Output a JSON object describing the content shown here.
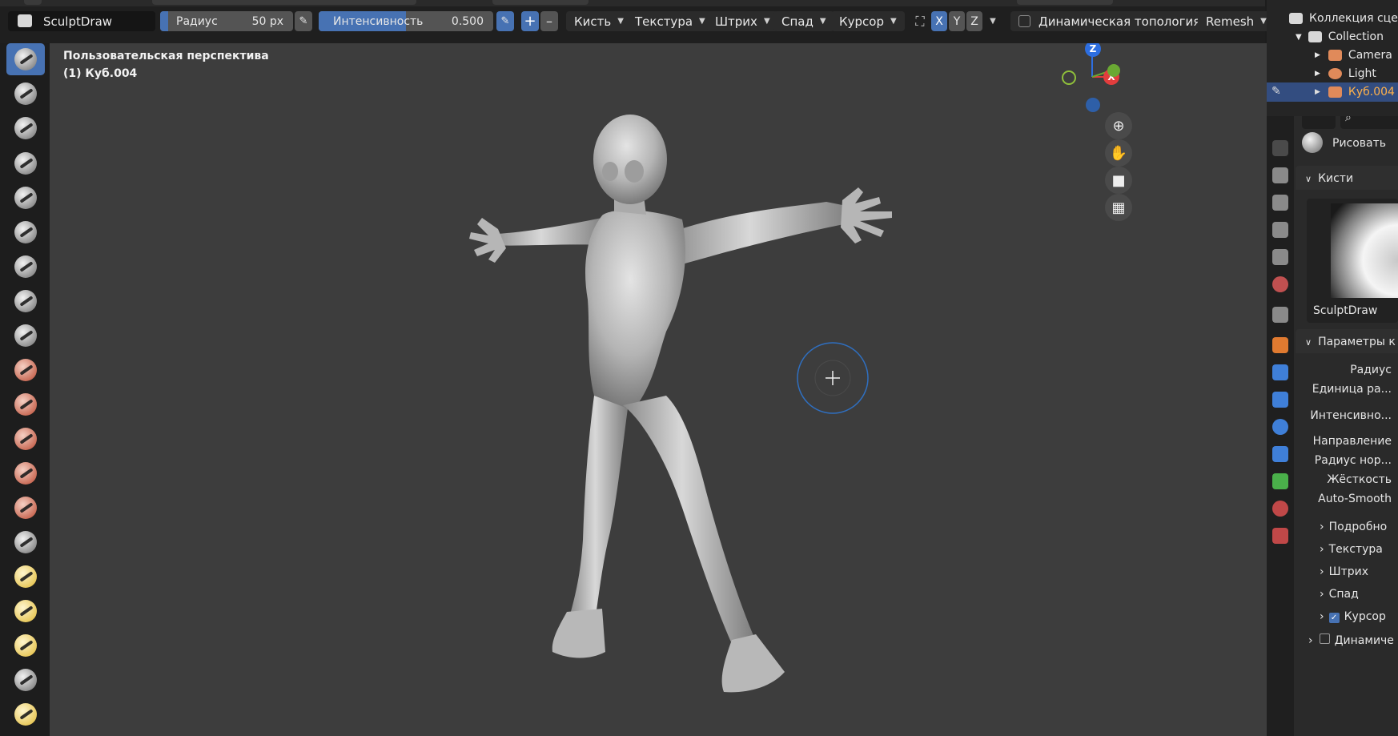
{
  "header": {
    "brush_name": "SculptDraw",
    "radius_label": "Радиус",
    "radius_value": "50 px",
    "strength_label": "Интенсивность",
    "strength_value": "0.500",
    "plus": "+",
    "minus": "–",
    "menus": [
      "Кисть",
      "Текстура",
      "Штрих",
      "Спад",
      "Курсор"
    ],
    "axes": [
      "X",
      "Y",
      "Z"
    ],
    "dyntopo_label": "Динамическая топология",
    "remesh_label": "Remesh"
  },
  "viewport": {
    "view_name": "Пользовательская перспектива",
    "object_name": "(1) Куб.004",
    "gizmo": {
      "z": "Z",
      "x": "X"
    }
  },
  "outliner": {
    "scene_collection": "Коллекция сце",
    "collection": "Collection",
    "items": [
      "Camera",
      "Light",
      "Куб.004"
    ]
  },
  "properties": {
    "tool_title": "Рисовать",
    "brushes_panel": "Кисти",
    "brush_preview_name": "SculptDraw",
    "settings_panel": "Параметры к",
    "fields": [
      "Радиус",
      "Единица ра...",
      "Интенсивно...",
      "Направление",
      "Радиус нор...",
      "Жёсткость",
      "Auto-Smooth"
    ],
    "subpanels": [
      "Подробно",
      "Текстура",
      "Штрих",
      "Спад",
      "Курсор"
    ],
    "dynamics_label": "Динамиче"
  },
  "colors": {
    "accent": "#4772b3",
    "viewport_bg": "#3d3d3d",
    "selected_text": "#ffb14a"
  }
}
